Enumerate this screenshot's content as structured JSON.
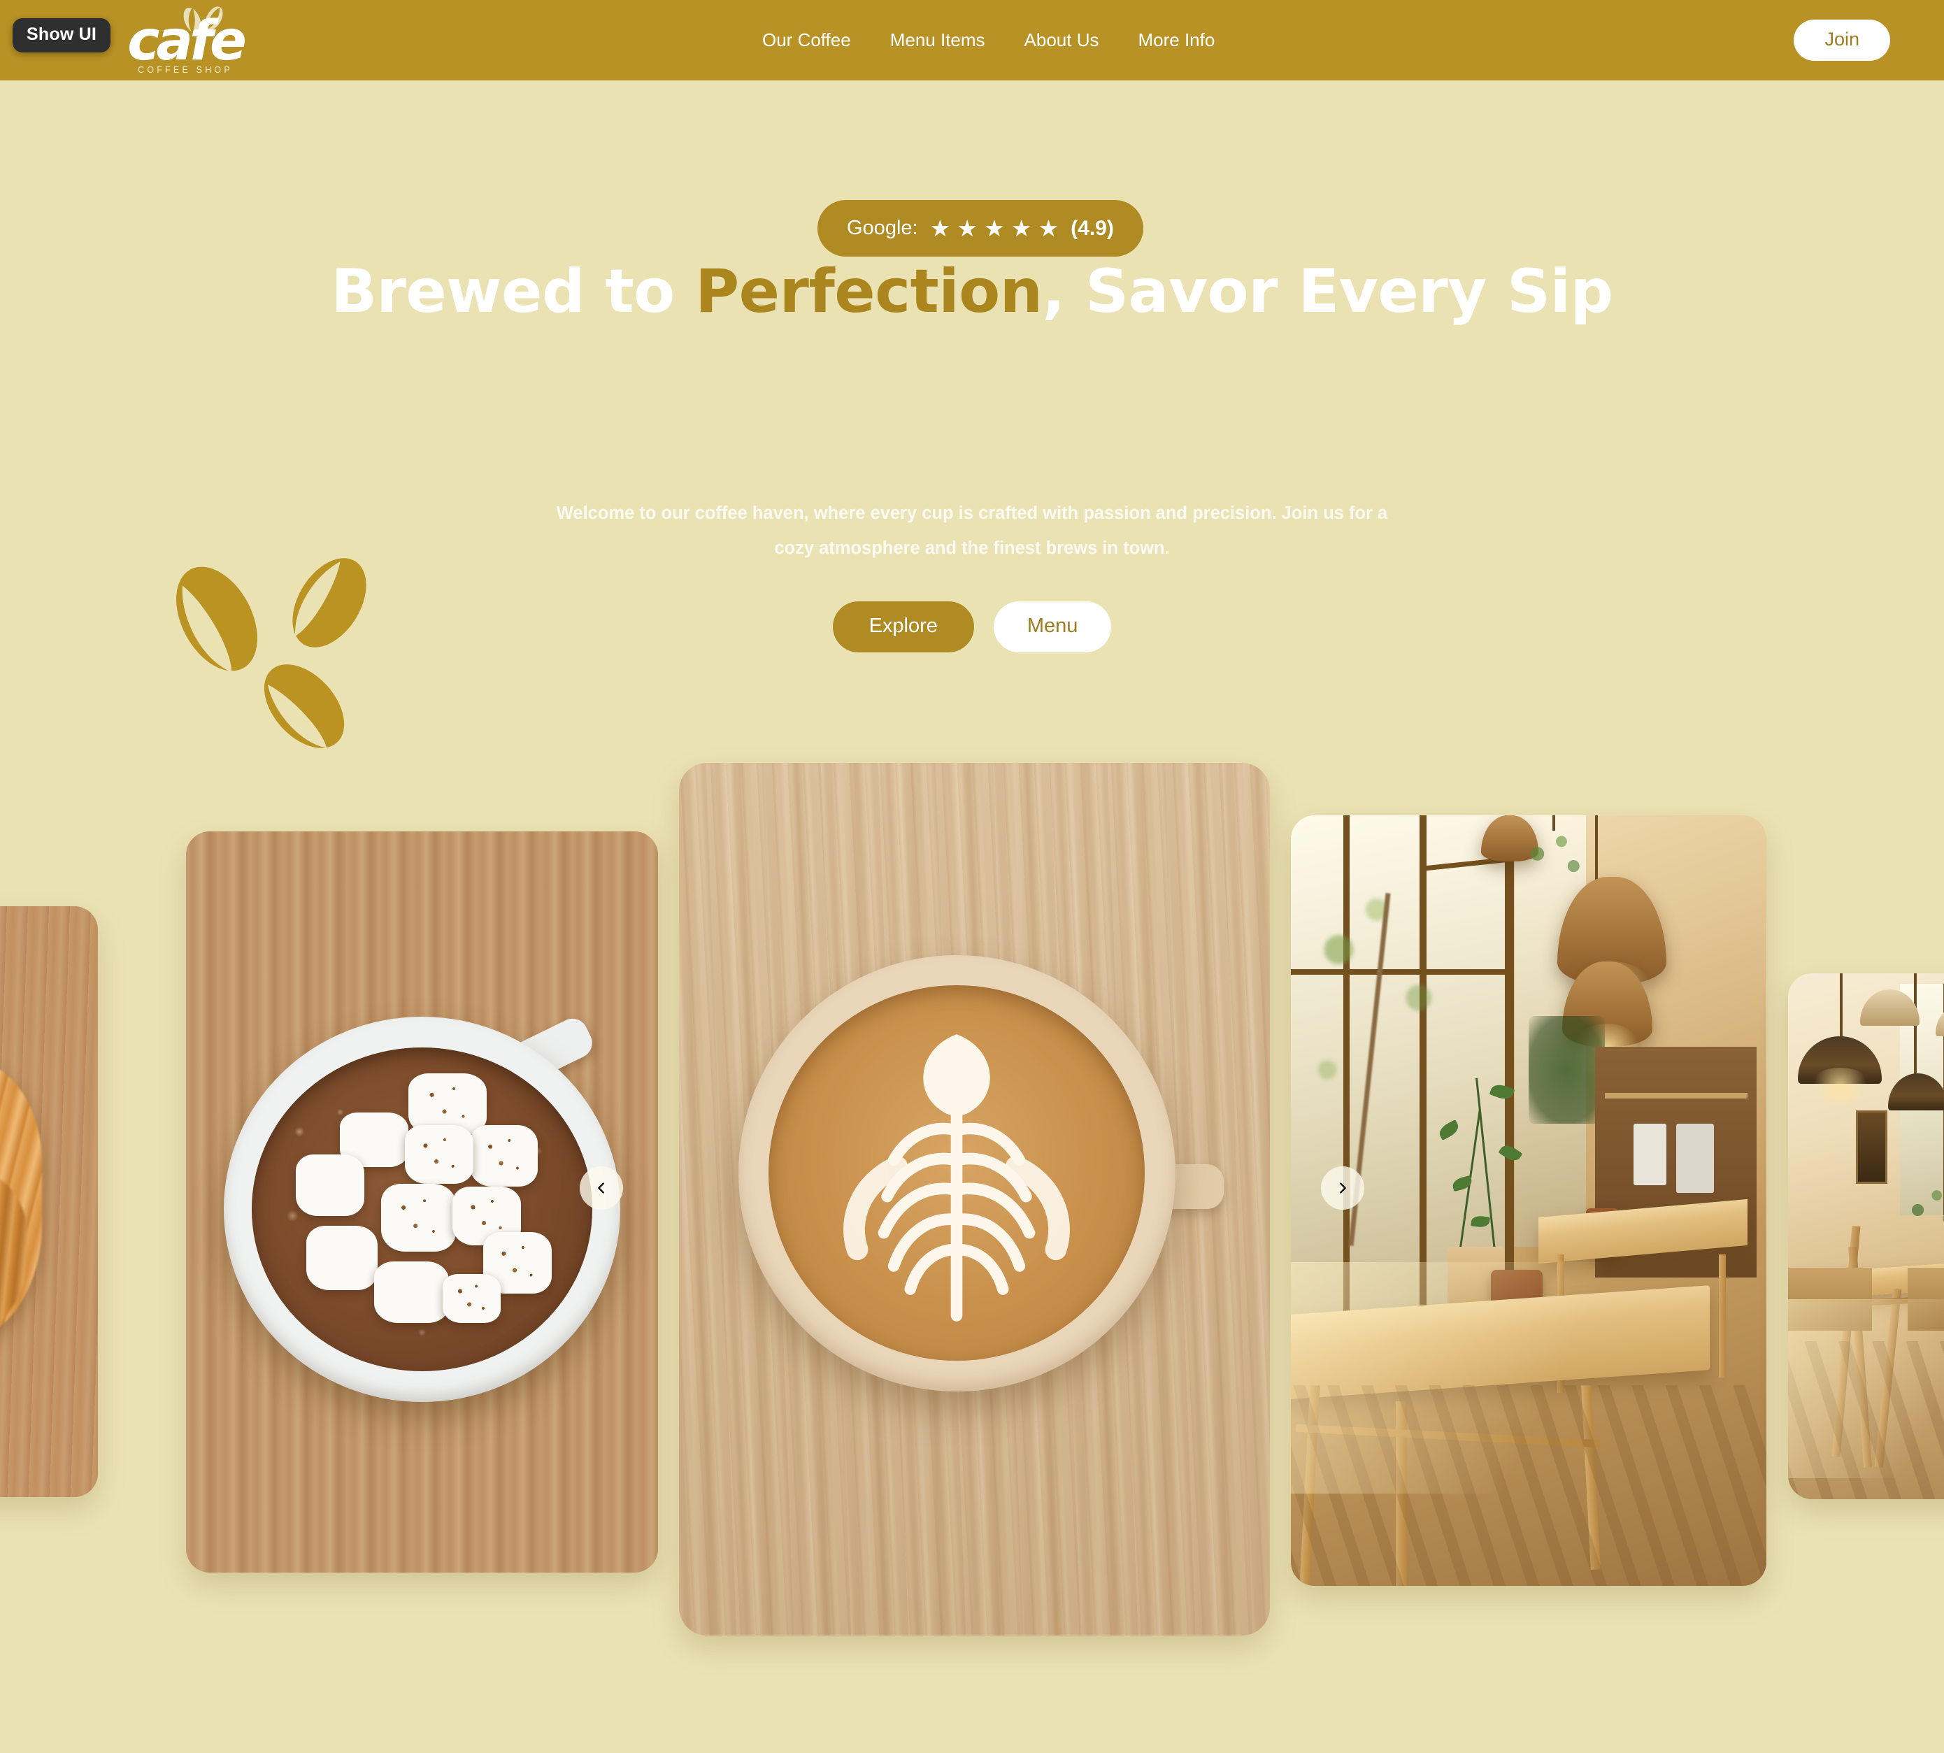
{
  "browser": {
    "show_ui_label": "Show UI"
  },
  "header": {
    "logo": {
      "word": "cafe",
      "tagline": "COFFEE SHOP",
      "beans_icon": "coffee-beans-icon"
    },
    "nav_items": [
      {
        "label": "Our Coffee"
      },
      {
        "label": "Menu Items"
      },
      {
        "label": "About Us"
      },
      {
        "label": "More Info"
      }
    ],
    "join_label": "Join",
    "background_color": "#b89224"
  },
  "hero": {
    "rating": {
      "label": "Google:",
      "stars": "★ ★ ★ ★ ★",
      "star_count": 5,
      "score": "(4.9)",
      "badge_color": "#b08a22"
    },
    "headline_lead": "Brewed to ",
    "headline_accent": "Perfection",
    "headline_tail": ", Savor Every Sip",
    "headline_accent_color": "#ab861f",
    "subhead": "Welcome to our coffee haven, where every cup is crafted with passion and precision. Join us for a cozy atmosphere and the finest brews in town.",
    "primary_cta": "Explore",
    "secondary_cta": "Menu",
    "decoration_icon": "coffee-beans-decoration-icon",
    "background_color": "#ebe2b4"
  },
  "carousel": {
    "prev_icon": "chevron-left-icon",
    "next_icon": "chevron-right-icon",
    "slides": [
      {
        "name": "croissant-on-wooden-table",
        "position": "far-left-partial"
      },
      {
        "name": "hot-chocolate-with-marshmallows",
        "position": "left"
      },
      {
        "name": "latte-art-cup-on-wood",
        "position": "center-featured"
      },
      {
        "name": "sunlit-cafe-interior-window-table",
        "position": "right"
      },
      {
        "name": "cafe-interior-pendant-lamps",
        "position": "far-right-partial"
      }
    ]
  }
}
